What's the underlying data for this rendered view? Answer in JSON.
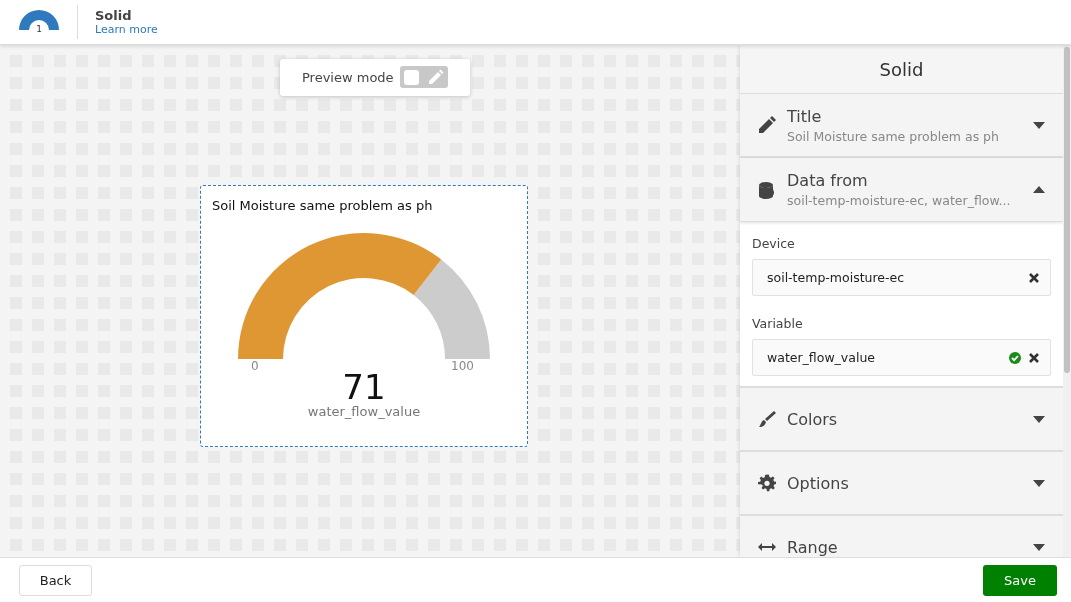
{
  "header": {
    "badge": "1",
    "title": "Solid",
    "link": "Learn more"
  },
  "preview": {
    "label": "Preview mode",
    "on": false
  },
  "widget": {
    "title": "Soil Moisture same problem as ph",
    "min": "0",
    "max": "100",
    "value": "71",
    "variable": "water_flow_value"
  },
  "panel": {
    "title": "Solid",
    "sections": [
      {
        "label": "Title",
        "subtitle": "Soil Moisture same problem as ph",
        "expanded": false
      },
      {
        "label": "Data from",
        "subtitle": "soil-temp-moisture-ec, water_flow...",
        "expanded": true,
        "fields": [
          {
            "label": "Device",
            "value": "soil-temp-moisture-ec",
            "valid": false
          },
          {
            "label": "Variable",
            "value": "water_flow_value",
            "valid": true
          }
        ]
      },
      {
        "label": "Colors",
        "expanded": false
      },
      {
        "label": "Options",
        "expanded": false
      },
      {
        "label": "Range",
        "expanded": false
      }
    ]
  },
  "footer": {
    "back": "Back",
    "save": "Save"
  }
}
